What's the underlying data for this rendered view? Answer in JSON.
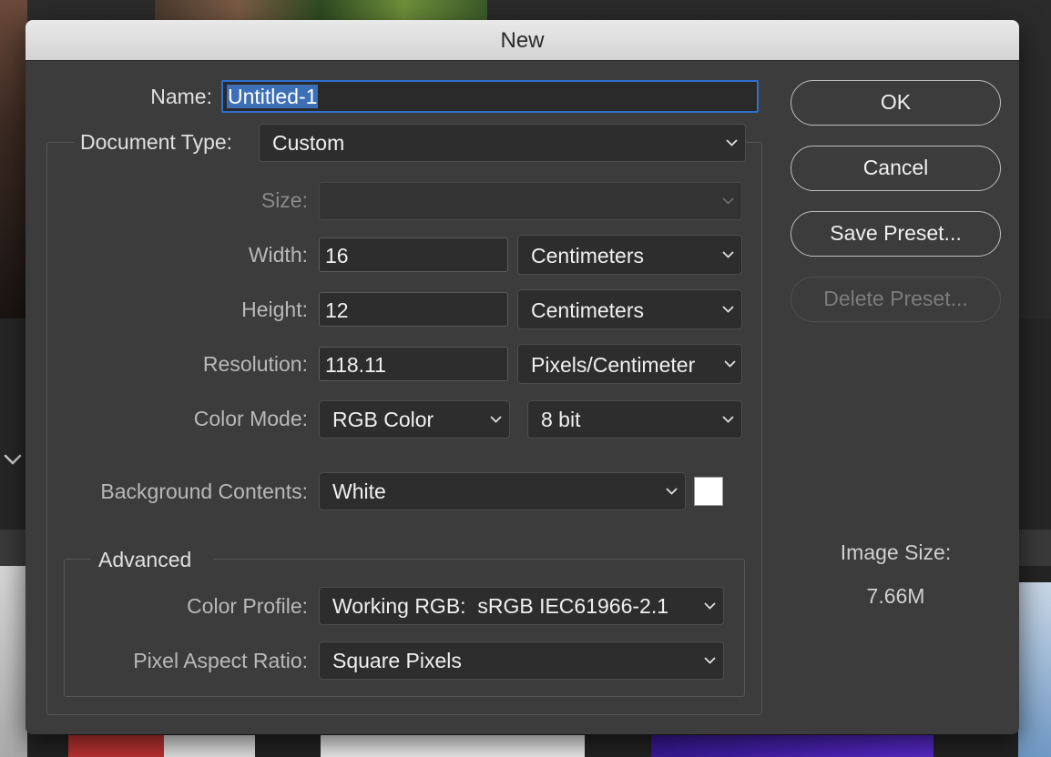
{
  "dialog": {
    "title": "New"
  },
  "name": {
    "label": "Name:",
    "value": "Untitled-1"
  },
  "document_type": {
    "label": "Document Type:",
    "value": "Custom"
  },
  "size": {
    "label": "Size:",
    "value": ""
  },
  "width": {
    "label": "Width:",
    "value": "16",
    "unit": "Centimeters"
  },
  "height": {
    "label": "Height:",
    "value": "12",
    "unit": "Centimeters"
  },
  "resolution": {
    "label": "Resolution:",
    "value": "118.11",
    "unit": "Pixels/Centimeter"
  },
  "color_mode": {
    "label": "Color Mode:",
    "mode": "RGB Color",
    "bits": "8 bit"
  },
  "background_contents": {
    "label": "Background Contents:",
    "value": "White",
    "swatch_color": "#ffffff"
  },
  "advanced": {
    "title": "Advanced",
    "color_profile": {
      "label": "Color Profile:",
      "value": "Working RGB:  sRGB IEC61966-2.1"
    },
    "pixel_aspect_ratio": {
      "label": "Pixel Aspect Ratio:",
      "value": "Square Pixels"
    }
  },
  "buttons": {
    "ok": "OK",
    "cancel": "Cancel",
    "save_preset": "Save Preset...",
    "delete_preset": "Delete Preset..."
  },
  "image_size": {
    "label": "Image Size:",
    "value": "7.66M"
  },
  "colors": {
    "accent": "#2f6fd0",
    "dialog_bg": "#3c3c3c"
  }
}
